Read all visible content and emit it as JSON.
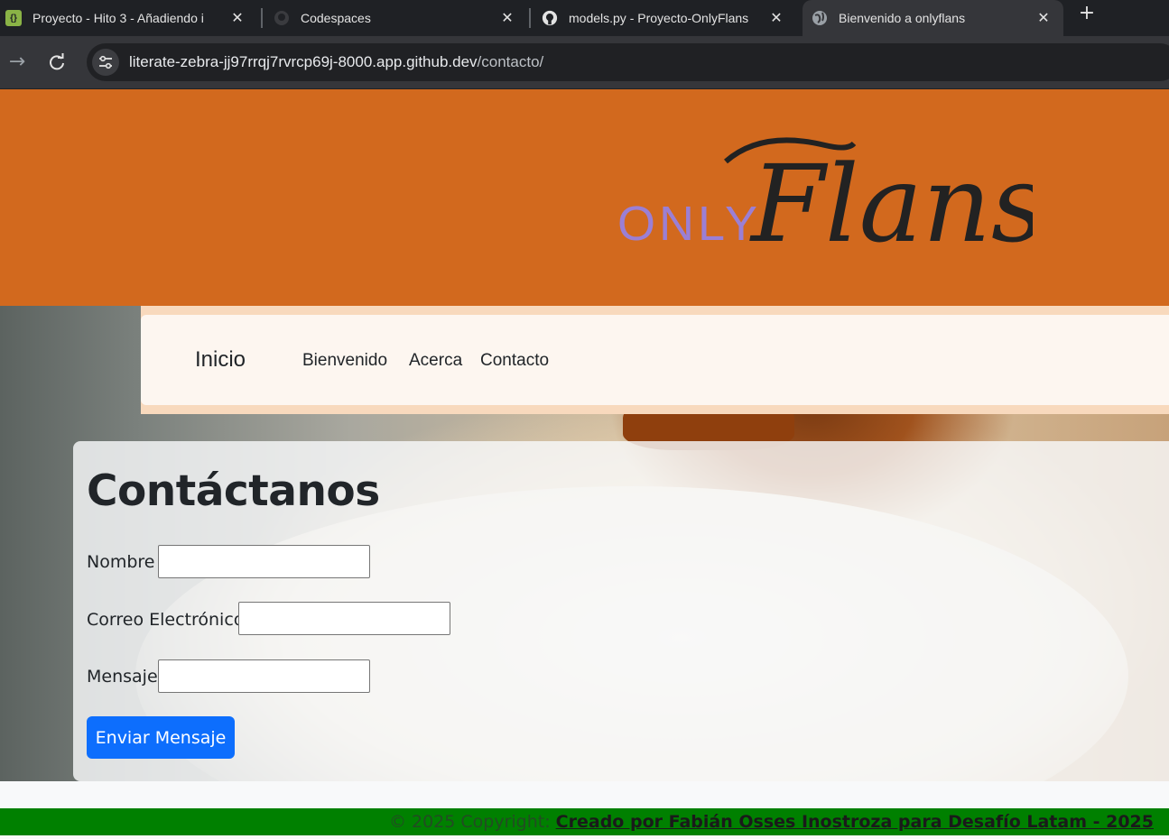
{
  "browser": {
    "tabs": [
      {
        "title": "Proyecto - Hito 3 - Añadiendo i",
        "icon": "brackets-app-icon",
        "active": false
      },
      {
        "title": "Codespaces",
        "icon": "github-icon",
        "active": false
      },
      {
        "title": "models.py - Proyecto-OnlyFlans",
        "icon": "github-icon",
        "active": false
      },
      {
        "title": "Bienvenido a onlyflans",
        "icon": "globe-icon",
        "active": true
      }
    ],
    "close_glyph": "✕",
    "new_tab_glyph": "+",
    "url_host": "literate-zebra-jj97rrqj7rvrcp69j-8000.app.github.dev",
    "url_path": "/contacto/"
  },
  "site": {
    "header_color": "#d2691e",
    "logo": {
      "prefix": "ONLY",
      "script": "Flans",
      "prefix_color": "#9b7fd4",
      "script_color": "#222222"
    },
    "nav": {
      "brand": "Inicio",
      "links": [
        "Bienvenido",
        "Acerca",
        "Contacto"
      ]
    },
    "contact": {
      "heading": "Contáctanos",
      "fields": [
        {
          "label": "Nombre",
          "value": ""
        },
        {
          "label": "Correo Electrónico",
          "value": ""
        },
        {
          "label": "Mensaje",
          "value": ""
        }
      ],
      "submit_label": "Enviar Mensaje",
      "button_color": "#0d6efd"
    },
    "footer": {
      "copyright": "© 2025 Copyright:",
      "credit_link": "Creado por Fabián Osses Inostroza para Desafío Latam - 2025",
      "background": "#008000"
    }
  }
}
